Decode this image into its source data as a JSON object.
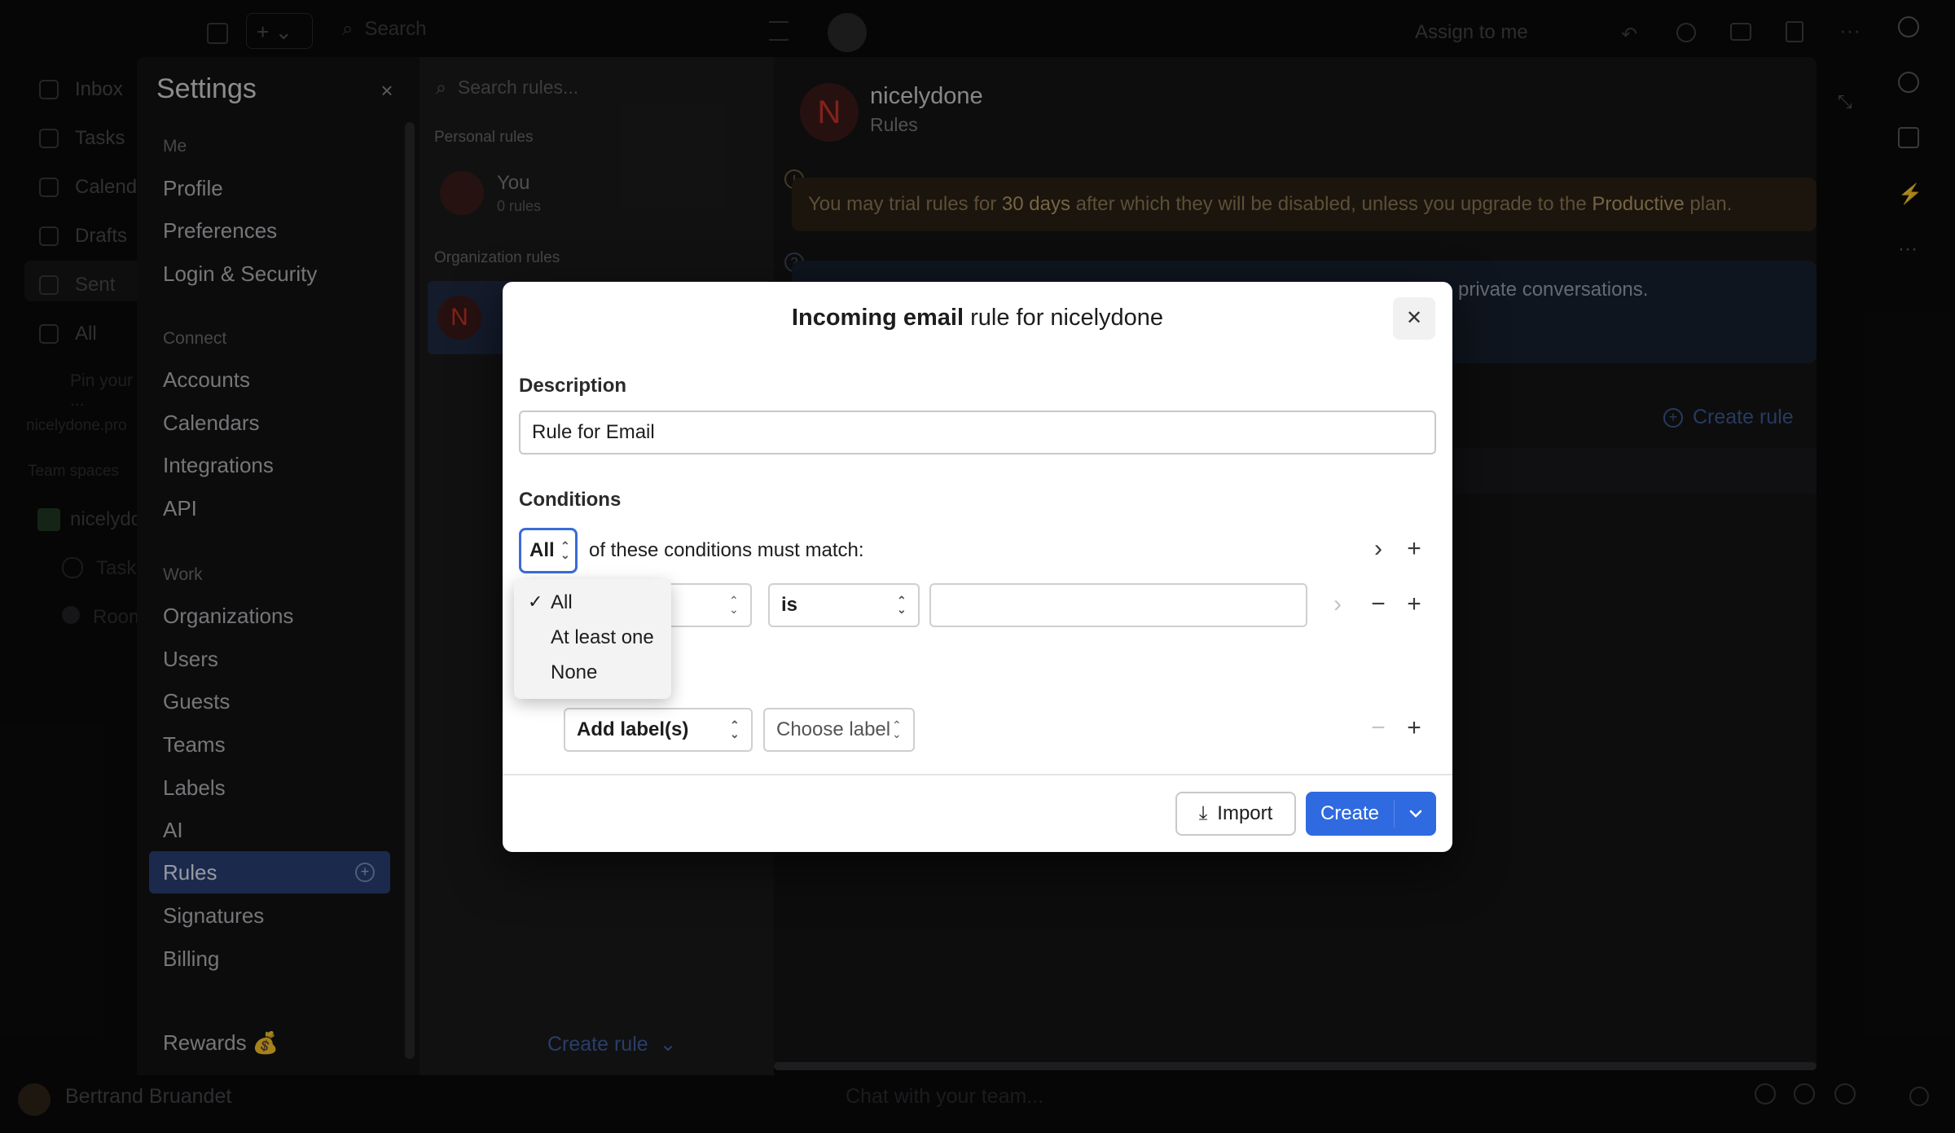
{
  "topbar": {
    "search_placeholder": "Search",
    "assign_label": "Assign to me"
  },
  "left_rail": {
    "items": [
      "Inbox",
      "Tasks",
      "Calendar",
      "Drafts",
      "Sent",
      "All"
    ],
    "more_label": "Pin your ...",
    "group_label": "nicelydone.pro",
    "team_label": "Team spaces",
    "workspace": "nicelydone",
    "sub_items": [
      "Tasks",
      "Room"
    ]
  },
  "bottombar": {
    "user_name": "Bertrand Bruandet",
    "chat_placeholder": "Chat with your team..."
  },
  "settings": {
    "title": "Settings",
    "sections": [
      {
        "label": "Me",
        "items": [
          "Profile",
          "Preferences",
          "Login & Security"
        ]
      },
      {
        "label": "Connect",
        "items": [
          "Accounts",
          "Calendars",
          "Integrations",
          "API"
        ]
      },
      {
        "label": "Work",
        "items": [
          "Organizations",
          "Users",
          "Guests",
          "Teams",
          "Labels",
          "AI",
          "Rules",
          "Signatures",
          "Billing"
        ]
      }
    ],
    "active_item": "Rules",
    "rewards_label": "Rewards 💰"
  },
  "rules_list": {
    "search_placeholder": "Search rules...",
    "personal_heading": "Personal rules",
    "personal_name": "You",
    "personal_count": "0 rules",
    "org_heading": "Organization rules",
    "org_initial": "N",
    "create_label": "Create rule"
  },
  "detail": {
    "org_initial": "N",
    "org_name": "nicelydone",
    "subtitle": "Rules",
    "warning_pre": "You may trial rules for ",
    "warning_days": "30 days",
    "warning_mid": " after which they will be disabled, unless you upgrade to the ",
    "warning_plan": "Productive",
    "warning_post": " plan.",
    "info_fragment": "private conversations.",
    "create_label": "Create rule"
  },
  "modal": {
    "title_strong": "Incoming email",
    "title_rest": " rule for nicelydone",
    "description_label": "Description",
    "description_value": "Rule for Email",
    "conditions_label": "Conditions",
    "match_value": "All",
    "match_text": "of these conditions must match:",
    "operator_value": "is",
    "action_value": "Add label(s)",
    "label_placeholder": "Choose label",
    "import_label": "Import",
    "create_label": "Create"
  },
  "match_dropdown": {
    "options": [
      "All",
      "At least one",
      "None"
    ],
    "selected": "All"
  },
  "colors": {
    "accent": "#2f6ae0",
    "active_nav": "#283f76"
  }
}
